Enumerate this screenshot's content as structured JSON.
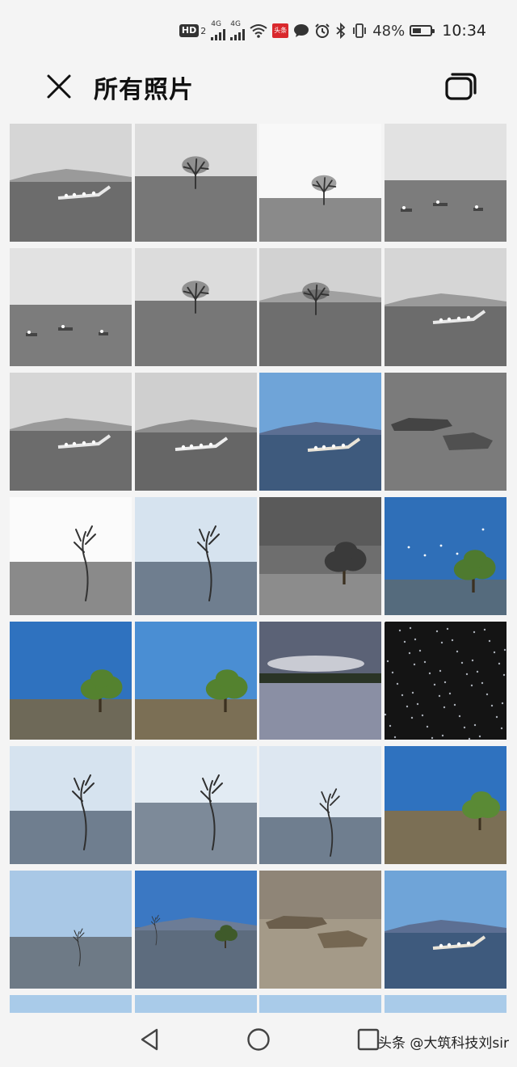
{
  "status_bar": {
    "hd_label": "HD",
    "sim_number": "2",
    "network1": "4G",
    "network2": "4G",
    "news_badge": "头条",
    "battery_percent": "48%",
    "battery_level": 0.48,
    "time": "10:34",
    "icons": [
      "signal-icon",
      "signal-icon",
      "wifi-icon",
      "news-app-icon",
      "message-icon",
      "alarm-icon",
      "bluetooth-icon",
      "vibrate-icon",
      "battery-icon"
    ]
  },
  "header": {
    "title": "所有照片",
    "close_icon": "close-icon",
    "multiselect_icon": "multi-window-icon"
  },
  "photos": [
    {
      "scene": "bw-horizon-mtn-driftwood"
    },
    {
      "scene": "bw-tree-horizon"
    },
    {
      "scene": "bw-tree-bright"
    },
    {
      "scene": "bw-birds-flat"
    },
    {
      "scene": "bw-birds-flat"
    },
    {
      "scene": "bw-tree-horizon"
    },
    {
      "scene": "bw-tree-mtn"
    },
    {
      "scene": "bw-horizon-mtn-driftwood"
    },
    {
      "scene": "bw-horizon-mtn-driftwood"
    },
    {
      "scene": "bw-mtn-driftwood-birds"
    },
    {
      "scene": "color-mtn-driftwood"
    },
    {
      "scene": "bw-rocks"
    },
    {
      "scene": "bw-thin-tree-bright"
    },
    {
      "scene": "blue-thin-tree"
    },
    {
      "scene": "bw-big-tree"
    },
    {
      "scene": "color-big-tree-birds"
    },
    {
      "scene": "color-big-tree"
    },
    {
      "scene": "color-big-tree-light"
    },
    {
      "scene": "dusk-shore"
    },
    {
      "scene": "night-sparkle"
    },
    {
      "scene": "blue-thin-tree"
    },
    {
      "scene": "blue-thin-tree-light"
    },
    {
      "scene": "blue-thin-tree-right"
    },
    {
      "scene": "color-big-tree-right"
    },
    {
      "scene": "blue-small-tree"
    },
    {
      "scene": "color-mtn-trees"
    },
    {
      "scene": "sepia-rocks"
    },
    {
      "scene": "color-mtn-driftwood"
    },
    {
      "scene": "partial"
    },
    {
      "scene": "partial"
    },
    {
      "scene": "partial"
    },
    {
      "scene": "partial"
    }
  ],
  "nav": {
    "back_icon": "back-triangle-icon",
    "home_icon": "home-circle-icon",
    "recent_icon": "recent-square-icon",
    "watermark": "头条 @大筑科技刘sir"
  },
  "colors": {
    "background": "#f4f4f4",
    "text": "#1a1a1a",
    "news_red": "#d9282d"
  }
}
